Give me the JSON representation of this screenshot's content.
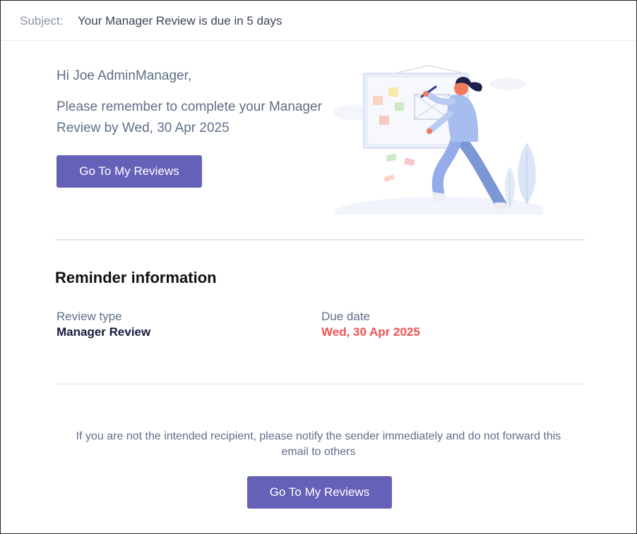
{
  "subject": {
    "label": "Subject:",
    "text": "Your Manager Review is due in 5 days"
  },
  "email": {
    "greeting": "Hi Joe AdminManager,",
    "message": "Please remember to complete your Manager Review by Wed, 30 Apr 2025",
    "cta_label": "Go To My Reviews",
    "illustration_icon": "person-drawing-on-board-illustration"
  },
  "reminder": {
    "heading": "Reminder information",
    "review_type_label": "Review type",
    "review_type_value": "Manager Review",
    "due_date_label": "Due date",
    "due_date_value": "Wed, 30 Apr 2025"
  },
  "footer": {
    "note": "If you are not the intended recipient, please notify the sender immediately and do not forward this email to others",
    "cta_label": "Go To My Reviews"
  },
  "colors": {
    "accent": "#6561b9",
    "due_date": "#ef5350",
    "body_text": "#5f6f88",
    "value_text": "#14193a"
  }
}
